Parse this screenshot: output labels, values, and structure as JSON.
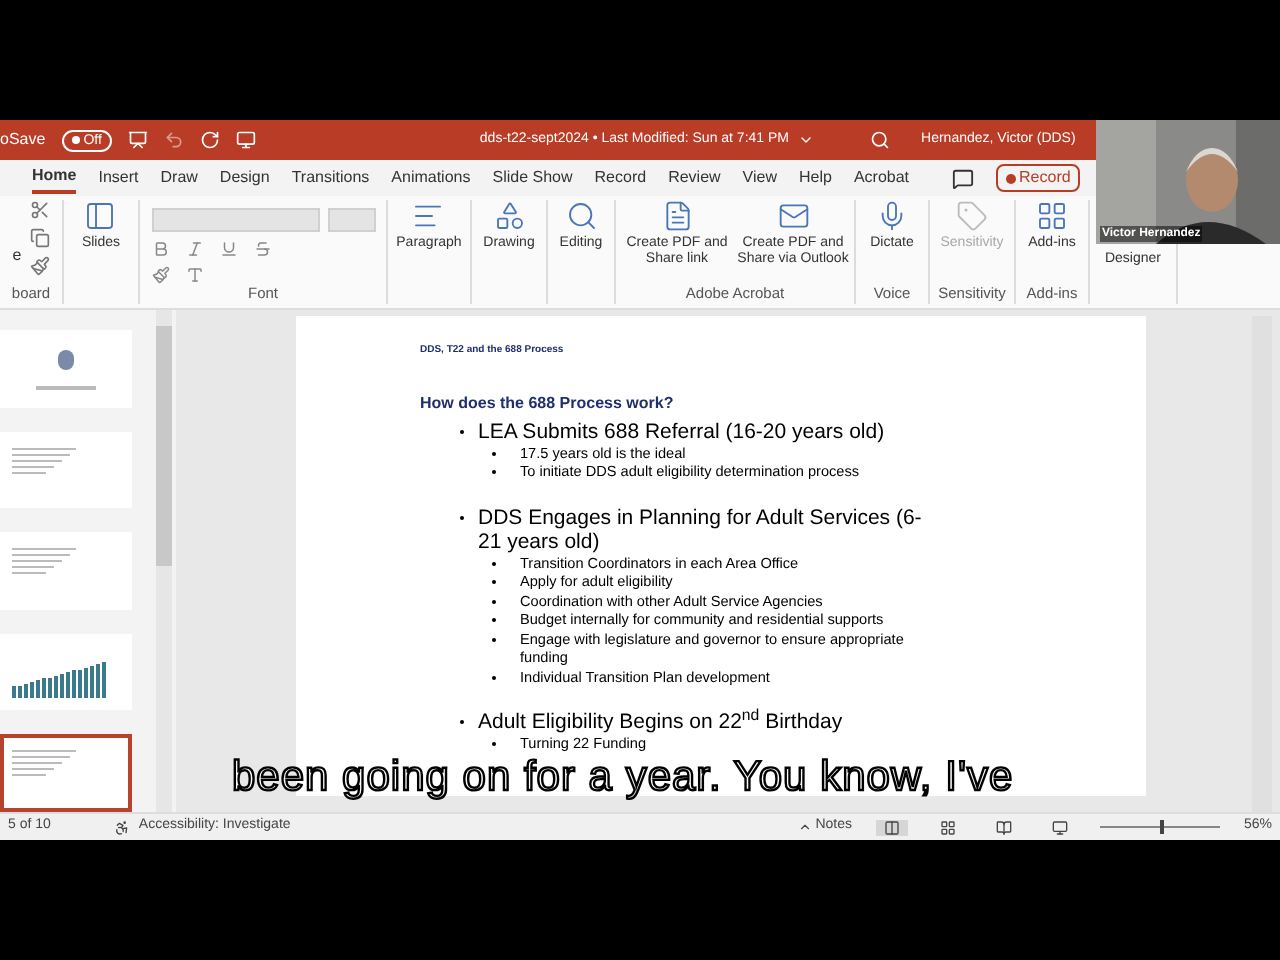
{
  "title_bar": {
    "autosave_label": "oSave",
    "autosave_toggle": {
      "label": "Off",
      "on": false
    },
    "document_title": "dds-t22-sept2024 • Last Modified: Sun at 7:41 PM",
    "user": "Hernandez, Victor (DDS)"
  },
  "ribbon_tabs": [
    {
      "label": "Home",
      "selected": true
    },
    {
      "label": "Insert",
      "selected": false
    },
    {
      "label": "Draw",
      "selected": false
    },
    {
      "label": "Design",
      "selected": false
    },
    {
      "label": "Transitions",
      "selected": false
    },
    {
      "label": "Animations",
      "selected": false
    },
    {
      "label": "Slide Show",
      "selected": false
    },
    {
      "label": "Record",
      "selected": false
    },
    {
      "label": "Review",
      "selected": false
    },
    {
      "label": "View",
      "selected": false
    },
    {
      "label": "Help",
      "selected": false
    },
    {
      "label": "Acrobat",
      "selected": false
    }
  ],
  "record_button": "Record",
  "ribbon_groups": [
    {
      "kind": "clipboard",
      "label": "board",
      "commands": [
        {
          "label": "e"
        }
      ]
    },
    {
      "kind": "large",
      "commands": [
        {
          "label": "Slides",
          "disabled": false
        }
      ]
    },
    {
      "kind": "font",
      "label": "Font"
    },
    {
      "kind": "large",
      "commands": [
        {
          "label": "Paragraph",
          "disabled": false
        }
      ]
    },
    {
      "kind": "large",
      "commands": [
        {
          "label": "Drawing",
          "disabled": false
        }
      ]
    },
    {
      "kind": "large",
      "commands": [
        {
          "label": "Editing",
          "disabled": false
        }
      ]
    },
    {
      "kind": "large",
      "label": "Adobe Acrobat",
      "commands": [
        {
          "label": "Create PDF and Share link",
          "disabled": false
        },
        {
          "label": "Create PDF and Share via Outlook",
          "disabled": false
        }
      ]
    },
    {
      "kind": "large",
      "label": "Voice",
      "commands": [
        {
          "label": "Dictate",
          "disabled": false
        }
      ]
    },
    {
      "kind": "large",
      "label": "Sensitivity",
      "commands": [
        {
          "label": "Sensitivity",
          "disabled": true
        }
      ]
    },
    {
      "kind": "large",
      "label": "Add-ins",
      "commands": [
        {
          "label": "Add-ins",
          "disabled": false
        }
      ]
    },
    {
      "kind": "large",
      "commands": [
        {
          "label": "Designer",
          "disabled": false
        }
      ]
    }
  ],
  "thumbnails": [
    {
      "kind": "title",
      "selected": false
    },
    {
      "kind": "text",
      "selected": false
    },
    {
      "kind": "text",
      "selected": false
    },
    {
      "kind": "chart",
      "selected": false
    },
    {
      "kind": "text",
      "selected": true
    }
  ],
  "slide": {
    "header": "DDS, T22 and the 688 Process",
    "title": "How does the 688 Process work?",
    "bullets": [
      {
        "text": "LEA Submits 688 Referral (16-20 years old)",
        "children": [
          "17.5 years old is the ideal",
          "To initiate DDS adult eligibility determination process"
        ]
      },
      {
        "text": "DDS Engages in Planning for Adult Services (6-21 years old)",
        "children": [
          "Transition Coordinators in each Area Office",
          "Apply for adult eligibility",
          "Coordination with other Adult Service Agencies",
          "Budget internally for community and residential supports",
          "Engage with legislature and governor to ensure appropriate funding",
          "Individual Transition Plan development"
        ]
      },
      {
        "text": "Adult Eligibility Begins on 22$^{nd}$ Birthday",
        "children": [
          "Turning 22 Funding"
        ]
      }
    ]
  },
  "status_bar": {
    "slide_counter": "5 of 10",
    "accessibility": "Accessibility: Investigate",
    "notes": "Notes",
    "views": [
      {
        "kind": "normal",
        "selected": true
      },
      {
        "kind": "sorter",
        "selected": false
      },
      {
        "kind": "reading",
        "selected": false
      },
      {
        "kind": "show",
        "selected": false
      }
    ],
    "zoom_slider": {
      "level": 0.5
    },
    "zoom": "56%"
  },
  "webcam": {
    "name": "Victor Hernandez"
  },
  "caption": "been going on for a year. You know, I've"
}
